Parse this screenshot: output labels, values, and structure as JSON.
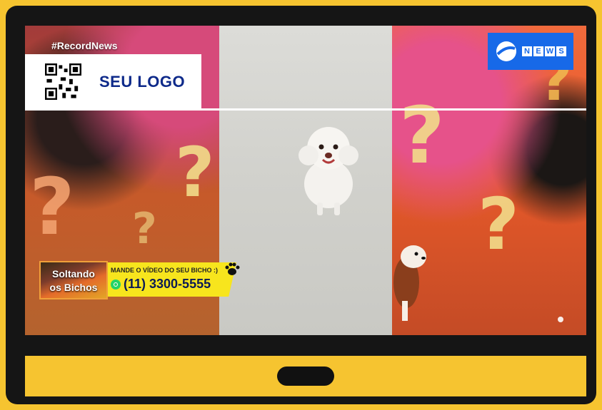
{
  "broadcast": {
    "hashtag": "#RecordNews",
    "sponsor_logo_text": "SEU LOGO",
    "channel_badge_letters": [
      "N",
      "E",
      "W",
      "S"
    ],
    "program_logo_line1": "Soltando",
    "program_logo_line2": "os Bichos",
    "ticker_prompt": "MANDE O VÍDEO DO SEU BICHO :)",
    "ticker_phone": "(11) 3300-5555"
  },
  "colors": {
    "frame_yellow": "#f6c430",
    "frame_black": "#151515",
    "news_blue": "#1769e8",
    "ticker_yellow": "#f7e51d",
    "logo_navy": "#0e2a8a"
  },
  "icons": [
    "qr-code-icon",
    "news-globe-icon",
    "whatsapp-icon",
    "paw-icon"
  ]
}
